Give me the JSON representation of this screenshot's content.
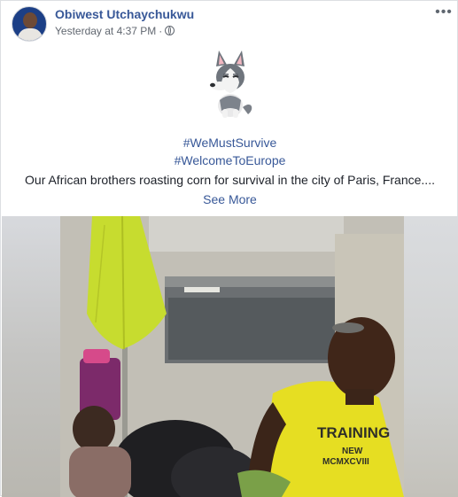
{
  "post": {
    "author": "Obiwest Utchaychukwu",
    "timestamp": "Yesterday at 4:37 PM",
    "separator": "·",
    "privacy_icon": "globe-icon",
    "more_label": "•••",
    "sticker_icon": "husky-dog-sticker",
    "hashtags": [
      "#WeMustSurvive",
      "#WelcomeToEurope"
    ],
    "caption": "Our African brothers roasting corn for survival in the city of Paris, France....",
    "see_more": "See More",
    "video_overlay_text": [
      "TRAINING",
      "NEW",
      "MCMXCVIII"
    ]
  },
  "colors": {
    "link": "#385898",
    "text": "#1d2129",
    "meta": "#616770",
    "umbrella": "#c7dc2f",
    "shirt": "#e6de22"
  }
}
